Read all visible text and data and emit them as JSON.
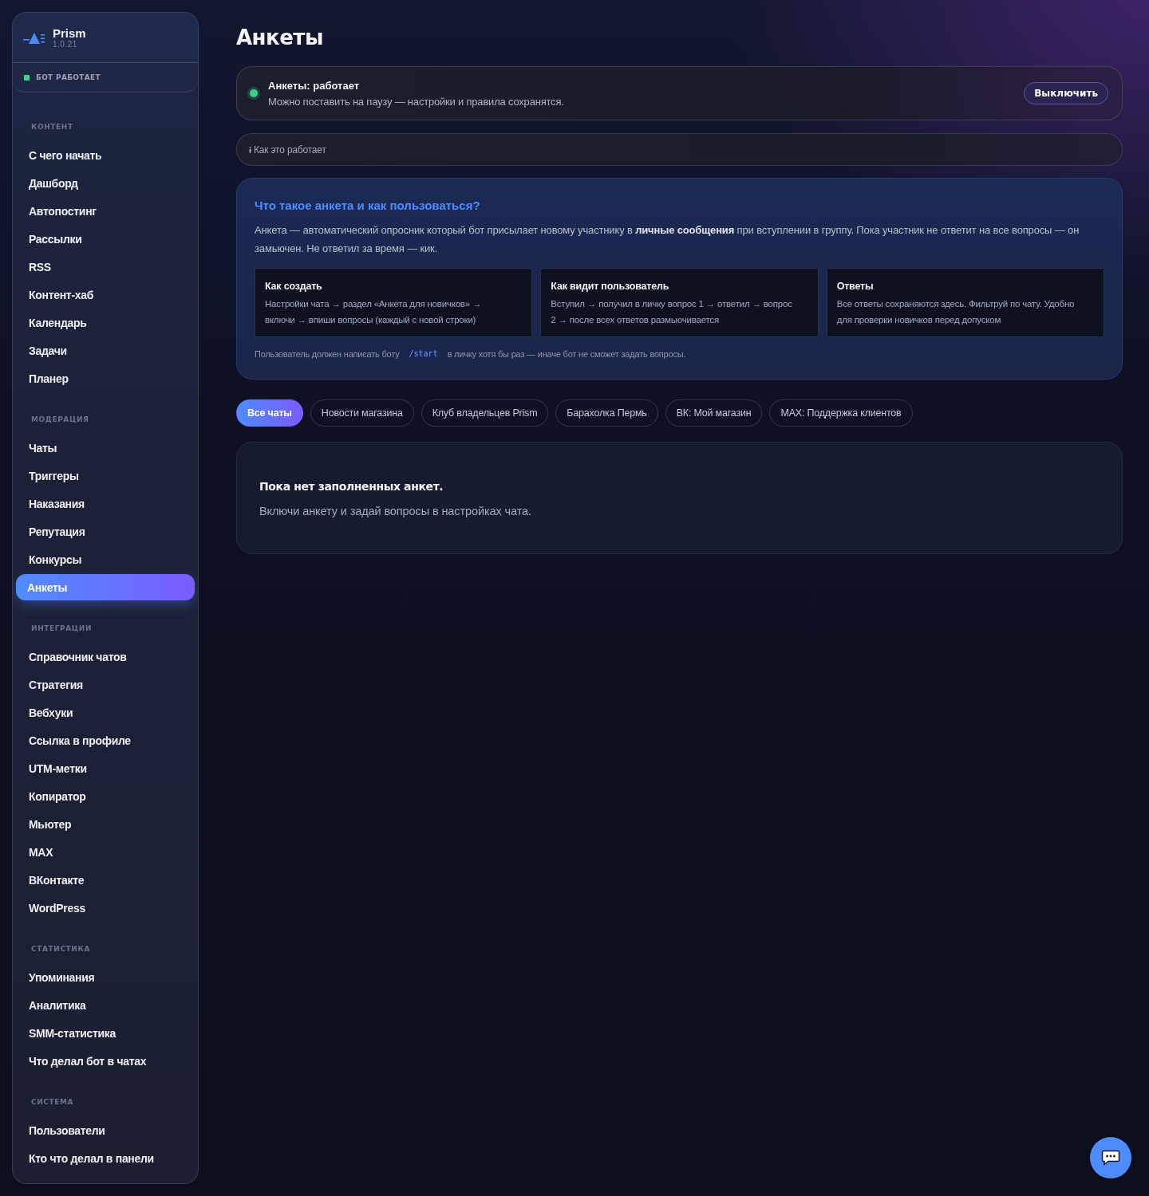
{
  "sidebar": {
    "brand": {
      "name": "Prism",
      "version": "1.0.21"
    },
    "bot_status": {
      "label": "БОТ РАБОТАЕТ",
      "on": true
    },
    "sections": [
      {
        "title": "КОНТЕНТ",
        "items": [
          {
            "label": "С чего начать",
            "selected": false
          },
          {
            "label": "Дашборд",
            "selected": false
          },
          {
            "label": "Автопостинг",
            "selected": false
          },
          {
            "label": "Рассылки",
            "selected": false
          },
          {
            "label": "RSS",
            "selected": false
          },
          {
            "label": "Контент-хаб",
            "selected": false
          },
          {
            "label": "Календарь",
            "selected": false
          },
          {
            "label": "Задачи",
            "selected": false
          },
          {
            "label": "Планер",
            "selected": false
          }
        ]
      },
      {
        "title": "МОДЕРАЦИЯ",
        "items": [
          {
            "label": "Чаты",
            "selected": false
          },
          {
            "label": "Триггеры",
            "selected": false
          },
          {
            "label": "Наказания",
            "selected": false
          },
          {
            "label": "Репутация",
            "selected": false
          },
          {
            "label": "Конкурсы",
            "selected": false
          },
          {
            "label": "Анкеты",
            "selected": true
          }
        ]
      },
      {
        "title": "ИНТЕГРАЦИИ",
        "items": [
          {
            "label": "Справочник чатов",
            "selected": false
          },
          {
            "label": "Стратегия",
            "selected": false
          },
          {
            "label": "Вебхуки",
            "selected": false
          },
          {
            "label": "Ссылка в профиле",
            "selected": false
          },
          {
            "label": "UTM-метки",
            "selected": false
          },
          {
            "label": "Копиратор",
            "selected": false
          },
          {
            "label": "Мьютер",
            "selected": false
          },
          {
            "label": "MAX",
            "selected": false
          },
          {
            "label": "ВКонтакте",
            "selected": false
          },
          {
            "label": "WordPress",
            "selected": false
          }
        ]
      },
      {
        "title": "СТАТИСТИКА",
        "items": [
          {
            "label": "Упоминания",
            "selected": false
          },
          {
            "label": "Аналитика",
            "selected": false
          },
          {
            "label": "SMM-статистика",
            "selected": false
          },
          {
            "label": "Что делал бот в чатах",
            "selected": false
          }
        ]
      },
      {
        "title": "СИСТЕМА",
        "items": [
          {
            "label": "Пользователи",
            "selected": false
          },
          {
            "label": "Кто что делал в панели",
            "selected": false
          }
        ]
      }
    ]
  },
  "page": {
    "title": "Анкеты"
  },
  "status_card": {
    "title": "Анкеты: работает",
    "subtitle": "Можно поставить на паузу — настройки и правила сохранятся.",
    "on": true,
    "button": "Выключить"
  },
  "how_it_works": {
    "label": "Как это работает"
  },
  "help": {
    "title": "Что такое анкета и как пользоваться?",
    "text": "Анкета — автоматический опросник который бот присылает новому участнику в **личные сообщения** при вступлении в группу. Пока участник не ответит на все вопросы — он замьючен. Не ответил за время — кик.",
    "cards": [
      {
        "title": "Как создать",
        "text": "Настройки чата → раздел «Анкета для новичков» → включи → впиши вопросы (каждый с новой строки)"
      },
      {
        "title": "Как видит пользователь",
        "text": "Вступил → получил в личку вопрос 1 → ответил → вопрос 2 → после всех ответов размьючивается"
      },
      {
        "title": "Ответы",
        "text": "Все ответы сохраняются здесь. Фильтруй по чату. Удобно для проверки новичков перед допуском"
      }
    ],
    "footnote": {
      "before": "Пользователь должен написать боту",
      "command": "/start",
      "after": "в личку хотя бы раз — иначе бот не сможет задать вопросы."
    }
  },
  "chat_filters": [
    {
      "label": "Все чаты",
      "selected": true
    },
    {
      "label": "Новости магазина",
      "selected": false
    },
    {
      "label": "Клуб владельцев Prism",
      "selected": false
    },
    {
      "label": "Барахолка Пермь",
      "selected": false
    },
    {
      "label": "ВК: Мой магазин",
      "selected": false
    },
    {
      "label": "MAX: Поддержка клиентов",
      "selected": false
    }
  ],
  "empty_state": {
    "title": "Пока нет заполненных анкет.",
    "text": "Включи анкету и задай вопросы в настройках чата."
  }
}
